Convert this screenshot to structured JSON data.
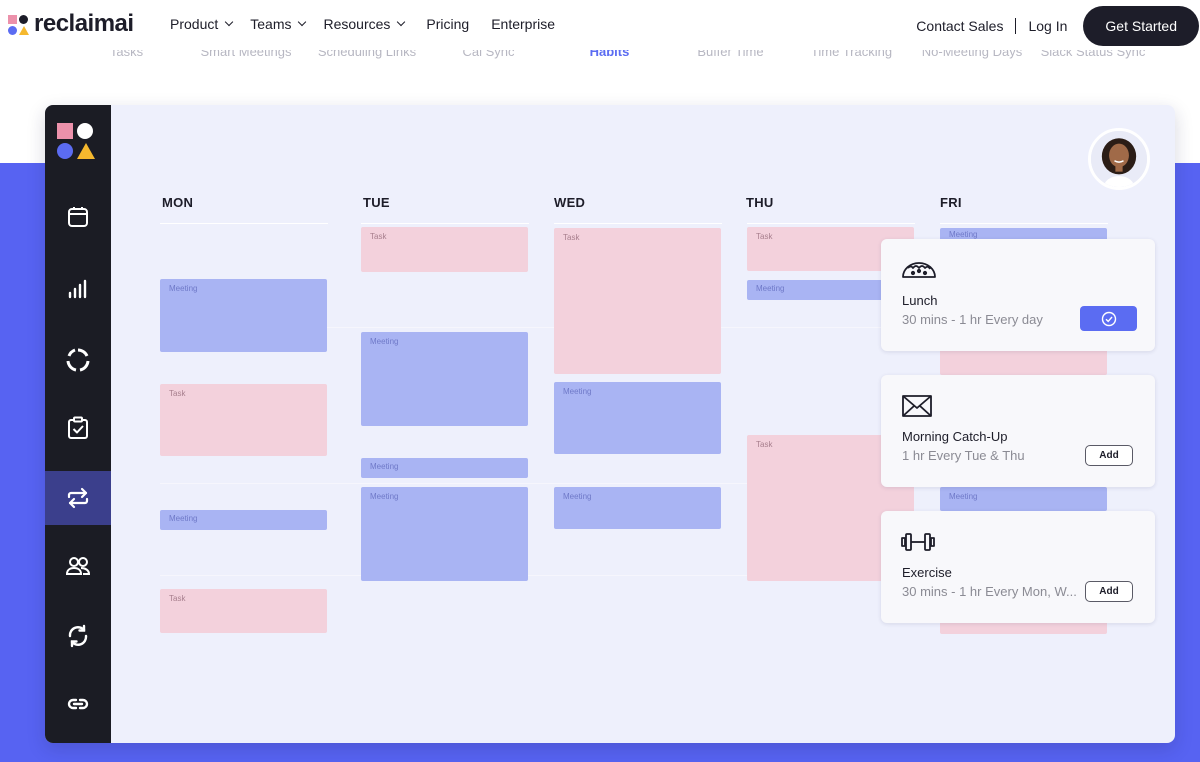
{
  "brand": {
    "logo_text": "reclaimai"
  },
  "nav": {
    "items": [
      {
        "label": "Product",
        "dropdown": true
      },
      {
        "label": "Teams",
        "dropdown": true
      },
      {
        "label": "Resources",
        "dropdown": true
      },
      {
        "label": "Pricing",
        "dropdown": false
      },
      {
        "label": "Enterprise",
        "dropdown": false
      }
    ],
    "contact": "Contact Sales",
    "login": "Log In",
    "cta": "Get Started"
  },
  "feature_tabs": [
    {
      "label": "Tasks",
      "active": false
    },
    {
      "label": "Smart Meetings",
      "active": false
    },
    {
      "label": "Scheduling Links",
      "active": false
    },
    {
      "label": "Cal Sync",
      "active": false
    },
    {
      "label": "Habits",
      "active": true
    },
    {
      "label": "Buffer Time",
      "active": false
    },
    {
      "label": "Time Tracking",
      "active": false
    },
    {
      "label": "No-Meeting Days",
      "active": false
    },
    {
      "label": "Slack Status Sync",
      "active": false
    }
  ],
  "sidebar_icons": [
    "calendar-icon",
    "stats-icon",
    "donut-icon",
    "clipboard-check-icon",
    "repeat-icon",
    "users-icon",
    "sync-icon",
    "link-icon"
  ],
  "calendar": {
    "days": [
      "MON",
      "TUE",
      "WED",
      "THU",
      "FRI"
    ],
    "task_label": "Task",
    "meeting_label": "Meeting"
  },
  "habits": [
    {
      "title": "Lunch",
      "subtitle": "30 mins - 1 hr Every day",
      "state": "added",
      "icon": "taco-icon"
    },
    {
      "title": "Morning Catch-Up",
      "subtitle": "1 hr Every Tue & Thu",
      "state": "add",
      "action": "Add",
      "icon": "mail-icon"
    },
    {
      "title": "Exercise",
      "subtitle": "30 mins - 1 hr Every Mon, W...",
      "state": "add",
      "action": "Add",
      "icon": "dumbbell-icon"
    }
  ],
  "colors": {
    "accent": "#5b6cf2",
    "task": "#f3d1dc",
    "meeting": "#a9b4f3",
    "sidebar": "#1b1c24",
    "hero": "#5763f2"
  }
}
